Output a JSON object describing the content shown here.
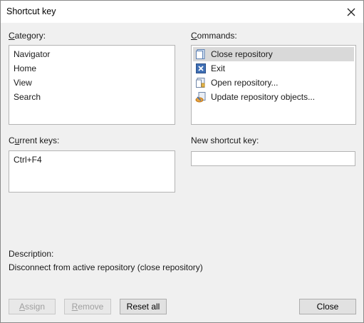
{
  "window": {
    "title": "Shortcut key"
  },
  "category": {
    "label_first": "C",
    "label_rest": "ategory:",
    "items": [
      "Navigator",
      "Home",
      "View",
      "Search"
    ]
  },
  "commands": {
    "label_first": "C",
    "label_rest": "ommands:",
    "items": [
      {
        "label": "Close repository",
        "icon": "close-repository-icon"
      },
      {
        "label": "Exit",
        "icon": "exit-icon"
      },
      {
        "label": "Open repository...",
        "icon": "open-repository-icon"
      },
      {
        "label": "Update repository objects...",
        "icon": "update-repository-icon"
      }
    ]
  },
  "current_keys": {
    "label_pre": "C",
    "label_u": "u",
    "label_post": "rrent keys:",
    "values": [
      "Ctrl+F4"
    ]
  },
  "new_shortcut": {
    "label": "New shortcut key:",
    "value": ""
  },
  "description": {
    "label": "Description:",
    "text": "Disconnect from active repository (close repository)"
  },
  "buttons": {
    "assign_first": "A",
    "assign_rest": "ssign",
    "remove_first": "R",
    "remove_rest": "emove",
    "reset_all": "Reset all",
    "close": "Close"
  },
  "colors": {
    "selected_row": "#d9d9d9",
    "dialog_bg": "#f0f0f0"
  }
}
